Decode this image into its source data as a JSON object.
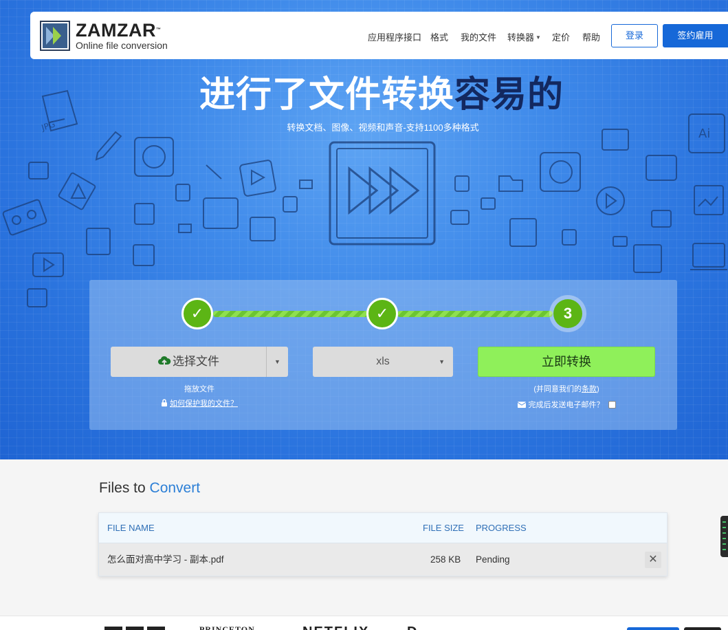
{
  "brand": {
    "name": "ZAMZAR",
    "trademark": "™",
    "tagline": "Online file conversion"
  },
  "nav": {
    "links": [
      {
        "label": "应用程序接口"
      },
      {
        "label": "格式"
      },
      {
        "label": "我的文件"
      },
      {
        "label": "转换器"
      },
      {
        "label": "定价"
      },
      {
        "label": "帮助"
      }
    ],
    "login_label": "登录",
    "signup_label": "签约雇用"
  },
  "hero": {
    "title_main": "进行了文件转换",
    "title_emphasis": "容易的",
    "subtitle": "转换文档、图像、视频和声音-支持1100多种格式"
  },
  "steps": [
    {
      "state": "done",
      "symbol": "✓"
    },
    {
      "state": "done",
      "symbol": "✓"
    },
    {
      "state": "current",
      "symbol": "3"
    }
  ],
  "converter": {
    "choose_label": "选择文件",
    "drop_label": "拖放文件",
    "protect_link": "如何保护我的文件？",
    "format_value": "xls",
    "convert_label": "立即转换",
    "terms_prefix": "(并同意我们的",
    "terms_link": "条款",
    "terms_suffix": ")",
    "email_label": "完成后发送电子邮件？"
  },
  "files": {
    "title_plain": "Files to",
    "title_accent": "Convert",
    "columns": {
      "name": "FILE NAME",
      "size": "FILE SIZE",
      "progress": "PROGRESS"
    },
    "rows": [
      {
        "name": "怎么面对高中学习 - 副本.pdf",
        "size": "258 KB",
        "progress": "Pending"
      }
    ],
    "remove_symbol": "✕"
  },
  "footer": {
    "logos": [
      "PRINCETON",
      "NETFLIX"
    ]
  },
  "colors": {
    "primary": "#1668d8",
    "accent_green": "#8ff05a",
    "step_green": "#5cb515",
    "title_dark": "#13285f"
  }
}
